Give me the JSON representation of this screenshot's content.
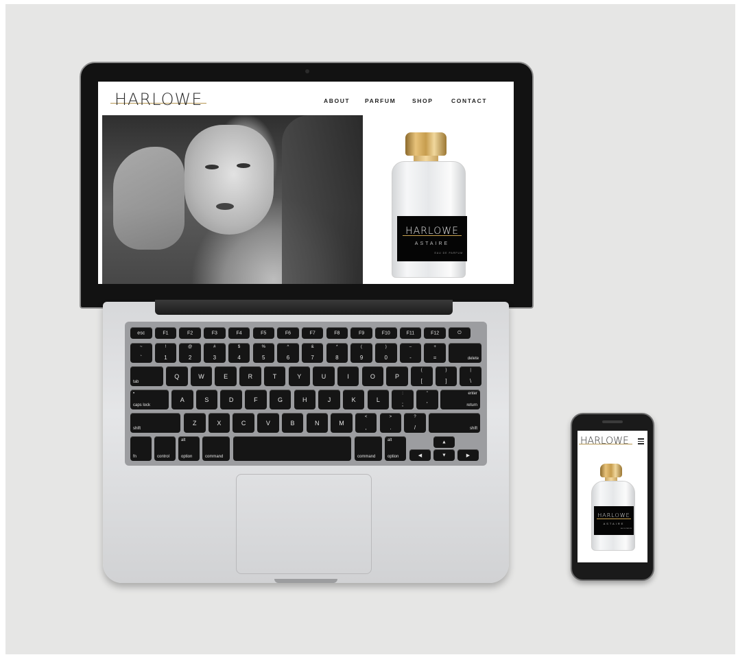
{
  "website": {
    "brand": "HARLOWE",
    "nav": [
      "ABOUT",
      "PARFUM",
      "SHOP",
      "CONTACT"
    ],
    "bottle_label": {
      "brand": "HARLOWE",
      "name": "ASTAIRE",
      "type": "EAU DE PARFUM"
    }
  },
  "keyboard": {
    "function_row": [
      "esc",
      "F1",
      "F2",
      "F3",
      "F4",
      "F5",
      "F6",
      "F7",
      "F8",
      "F9",
      "F10",
      "F11",
      "F12",
      "⏻"
    ],
    "number_row": [
      {
        "top": "~",
        "bot": "`"
      },
      {
        "top": "!",
        "bot": "1"
      },
      {
        "top": "@",
        "bot": "2"
      },
      {
        "top": "#",
        "bot": "3"
      },
      {
        "top": "$",
        "bot": "4"
      },
      {
        "top": "%",
        "bot": "5"
      },
      {
        "top": "^",
        "bot": "6"
      },
      {
        "top": "&",
        "bot": "7"
      },
      {
        "top": "*",
        "bot": "8"
      },
      {
        "top": "(",
        "bot": "9"
      },
      {
        "top": ")",
        "bot": "0"
      },
      {
        "top": "–",
        "bot": "-"
      },
      {
        "top": "+",
        "bot": "="
      }
    ],
    "delete": "delete",
    "tab": "tab",
    "row_q": [
      "Q",
      "W",
      "E",
      "R",
      "T",
      "Y",
      "U",
      "I",
      "O",
      "P"
    ],
    "row_q_extra": [
      {
        "top": "{",
        "bot": "["
      },
      {
        "top": "}",
        "bot": "]"
      },
      {
        "top": "|",
        "bot": "\\"
      }
    ],
    "caps": "caps lock",
    "row_a": [
      "A",
      "S",
      "D",
      "F",
      "G",
      "H",
      "J",
      "K",
      "L"
    ],
    "row_a_extra": [
      {
        "top": ":",
        "bot": ";"
      },
      {
        "top": "\"",
        "bot": "'"
      }
    ],
    "enter_top": "enter",
    "enter": "return",
    "shift": "shift",
    "row_z": [
      "Z",
      "X",
      "C",
      "V",
      "B",
      "N",
      "M"
    ],
    "row_z_extra": [
      {
        "top": "<",
        "bot": ","
      },
      {
        "top": ">",
        "bot": "."
      },
      {
        "top": "?",
        "bot": "/"
      }
    ],
    "fn": "fn",
    "control": "control",
    "alt": "alt",
    "option": "option",
    "command": "command",
    "arrow_left": "◀",
    "arrow_up": "▲",
    "arrow_down": "▼",
    "arrow_right": "▶"
  },
  "colors": {
    "gold": "#b59651",
    "background": "#e6e6e5"
  }
}
